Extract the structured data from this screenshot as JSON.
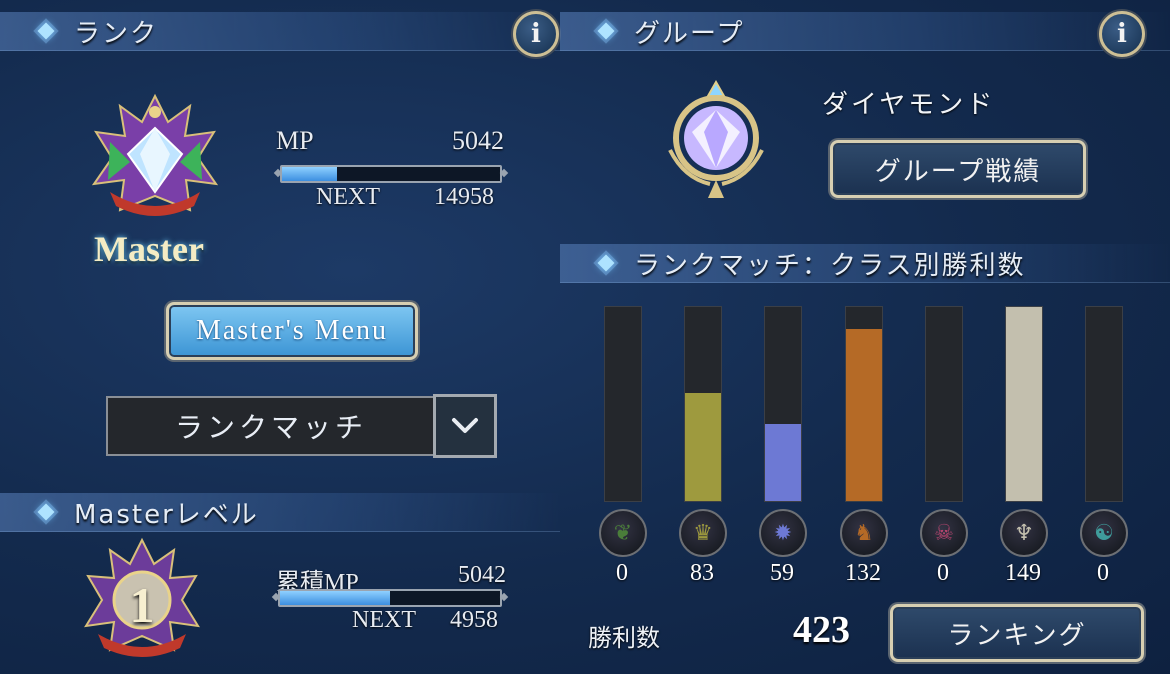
{
  "rank": {
    "header": "ランク",
    "rank_name": "Master",
    "mp_label": "MP",
    "mp_value": "5042",
    "mp_progress": 0.25,
    "next_label": "NEXT",
    "next_value": "14958",
    "masters_menu_label": "Master's Menu",
    "mode_select_value": "ランクマッチ"
  },
  "master_level": {
    "header": "Masterレベル",
    "level": "1",
    "cumulative_mp_label": "累積MP",
    "cumulative_mp_value": "5042",
    "mp_progress": 0.5,
    "next_label": "NEXT",
    "next_value": "4958"
  },
  "group": {
    "header": "グループ",
    "group_name": "ダイヤモンド",
    "group_results_label": "グループ戦績"
  },
  "class_wins": {
    "header": "ランクマッチ：クラス別勝利数",
    "wins_label": "勝利数",
    "total_wins": "423",
    "ranking_label": "ランキング"
  },
  "chart_data": {
    "type": "bar",
    "categories": [
      "forestcraft",
      "swordcraft",
      "runecraft",
      "dragoncraft",
      "shadowcraft",
      "bloodcraft",
      "havencraft"
    ],
    "values": [
      0,
      83,
      59,
      132,
      0,
      149,
      0
    ],
    "ylim": [
      0,
      149
    ],
    "colors": [
      "#4a7d3a",
      "#9e9a3e",
      "#6d79d4",
      "#b56a26",
      "#b8456f",
      "#c3bfae",
      "#3f9c9b"
    ],
    "icons": [
      "leaf-icon",
      "crown-icon",
      "rune-star-icon",
      "dragon-icon",
      "skull-icon",
      "bat-wing-icon",
      "haven-sigil-icon"
    ]
  }
}
